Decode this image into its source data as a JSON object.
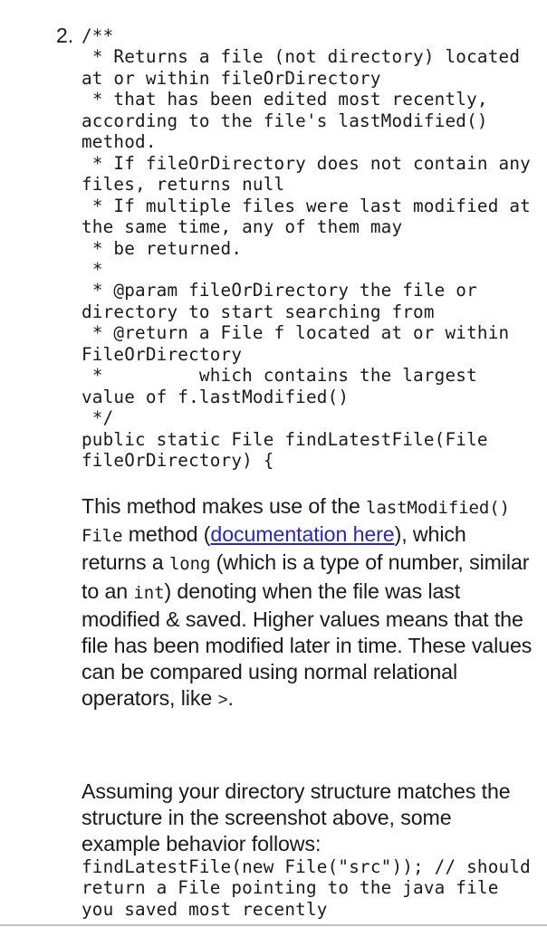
{
  "list_item": {
    "marker": "2.",
    "code_block": [
      "/**",
      " * Returns a file (not directory) located at or within fileOrDirectory",
      " * that has been edited most recently, according to the file's lastModified() method.",
      " * If fileOrDirectory does not contain any files, returns null",
      " * If multiple files were last modified at the same time, any of them may",
      " * be returned.",
      " *",
      " * @param fileOrDirectory the file or directory to start searching from",
      " * @return a File f located at or within FileOrDirectory",
      " *         which contains the largest value of f.lastModified()",
      " */",
      "public static File findLatestFile(File fileOrDirectory) {"
    ],
    "paragraph1": {
      "text_1": "This method makes use of the ",
      "code_1": "lastModified()",
      "text_2": " ",
      "code_2": "File",
      "text_3": " method (",
      "link_text": "documentation here",
      "text_4": "), which returns a ",
      "code_3": "long",
      "text_5": " (which is a type of number, similar to an ",
      "code_4": "int",
      "text_6": ") denoting when the file was last modified & saved. Higher values means that the file has been modified later in time. These values can be compared using normal relational operators, like ",
      "code_5": ">",
      "text_7": "."
    },
    "paragraph2": "Assuming your directory structure matches the structure in the screenshot above, some example behavior follows:",
    "example_code": "findLatestFile(new File(\"src\")); // should return a File pointing to the java file you saved most recently"
  },
  "colors": {
    "text": "#1a1a1a",
    "link": "#2a2ab0",
    "background": "#ffffff",
    "bottom_rule": "#bdbdbd"
  }
}
